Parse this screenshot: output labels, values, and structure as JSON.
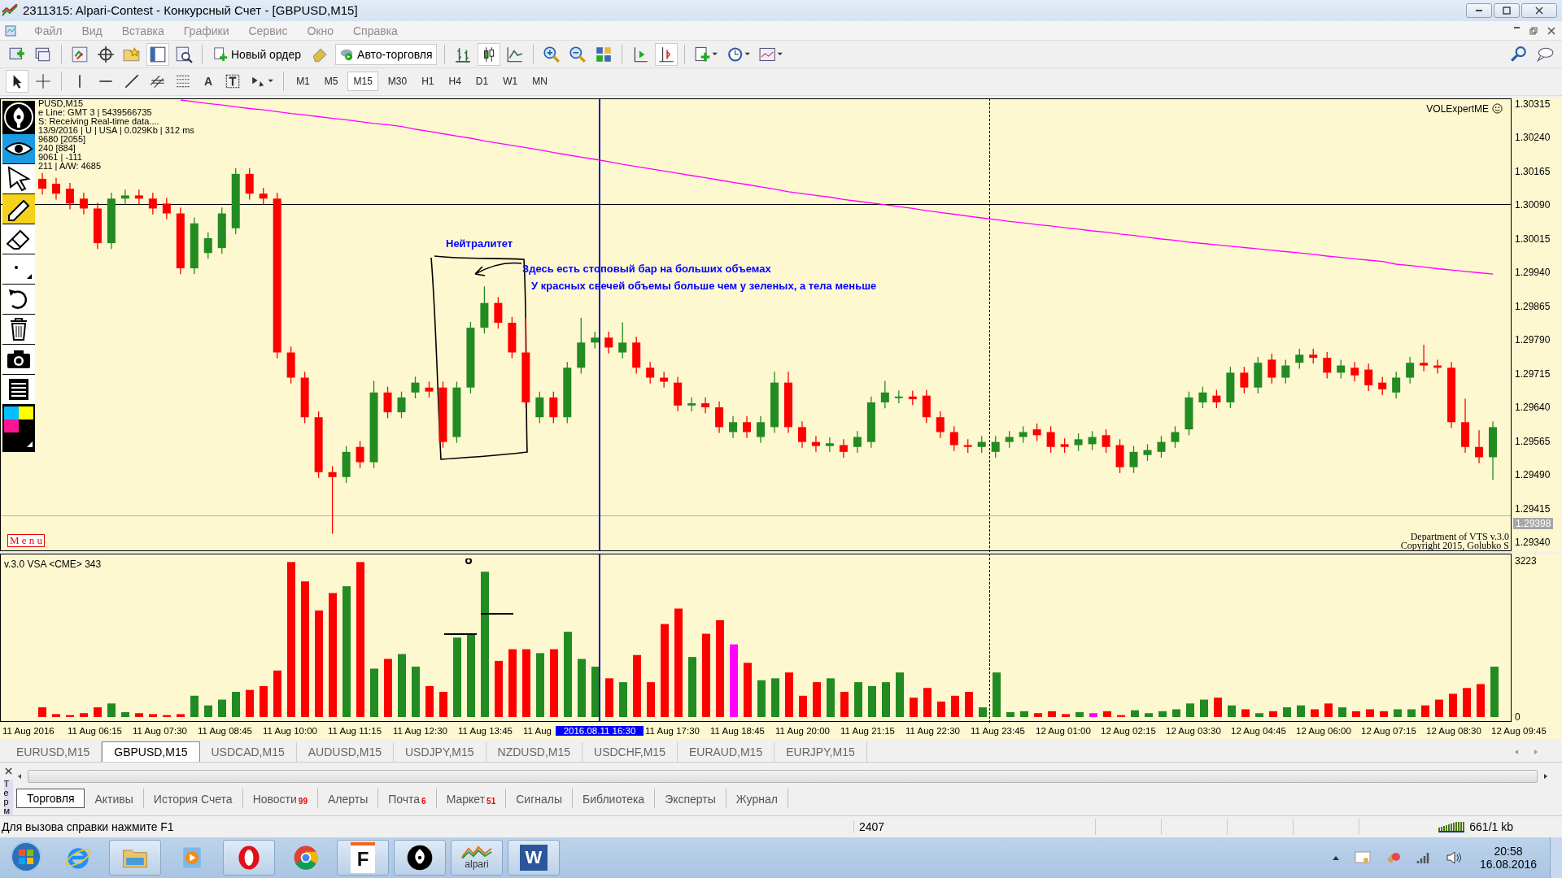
{
  "window": {
    "title": "2311315: Alpari-Contest - Конкурсный Счет - [GBPUSD,M15]"
  },
  "menu": [
    "Файл",
    "Вид",
    "Вставка",
    "Графики",
    "Сервис",
    "Окно",
    "Справка"
  ],
  "toolbar": {
    "new_order": "Новый ордер",
    "auto_trading": "Авто-торговля",
    "text_tool": "A"
  },
  "timeframes": [
    {
      "label": "M1",
      "selected": false
    },
    {
      "label": "M5",
      "selected": false
    },
    {
      "label": "M15",
      "selected": true
    },
    {
      "label": "M30",
      "selected": false
    },
    {
      "label": "H1",
      "selected": false
    },
    {
      "label": "H4",
      "selected": false
    },
    {
      "label": "D1",
      "selected": false
    },
    {
      "label": "W1",
      "selected": false
    },
    {
      "label": "MN",
      "selected": false
    }
  ],
  "chart": {
    "info_lines": [
      "PUSD,M15",
      "e Line: GMT 3 | 5439566735",
      "S:  Receiving Real-time data....",
      "13/9/2016 | U | USA | 0.029Kb | 312 ms",
      "9680  [2055]",
      "240  [884]",
      "9061 | -111",
      "211 | A/W: 4685"
    ],
    "expert": "VOLExpertME",
    "menu_label": "M e n u",
    "credits": [
      "Department of VTS  v.3.0",
      "Copyright 2015, Golubko S"
    ],
    "annotations": [
      "Нейтралитет",
      "Здесь есть стоповый бар на больших объемах",
      "У красных свечей объемы больше чем у зеленых, а тела меньше"
    ],
    "current_price": "1.29398",
    "chart_data": {
      "type": "candlestick",
      "ylim": [
        1.29323,
        1.30326
      ],
      "ref_lines": [
        {
          "axis": "y",
          "value": 1.3009,
          "color": "#000000"
        },
        {
          "axis": "y",
          "value": 1.29398,
          "color": "#b0b0b0"
        }
      ],
      "series": [
        {
          "type": "line",
          "color": "#ff00ff",
          "values": [
            null,
            null,
            null,
            null,
            null,
            null,
            null,
            null,
            null,
            null,
            1.30323,
            1.30319,
            1.30315,
            1.30312,
            1.30308,
            1.30304,
            1.30301,
            1.30297,
            1.30293,
            1.3029,
            1.30286,
            1.30282,
            1.30279,
            1.30275,
            1.30271,
            1.30268,
            1.30264,
            1.30258,
            1.30253,
            1.30248,
            1.30243,
            1.30238,
            1.30232,
            1.30227,
            1.30222,
            1.30217,
            1.30212,
            1.30206,
            1.30201,
            1.30196,
            1.30191,
            1.30186,
            1.3018,
            1.30175,
            1.3017,
            1.30165,
            1.3016,
            1.30155,
            1.3015,
            1.30145,
            1.3014,
            1.30135,
            1.3013,
            1.30125,
            1.30119,
            1.30115,
            1.30111,
            1.30107,
            1.30102,
            1.30098,
            1.30094,
            1.3009,
            1.30086,
            1.30082,
            1.30077,
            1.30073,
            1.30069,
            1.30065,
            1.30061,
            1.30057,
            1.30053,
            1.3005,
            1.30046,
            1.30043,
            1.30039,
            1.30036,
            1.30032,
            1.30029,
            1.30025,
            1.30022,
            1.30018,
            1.30014,
            1.30011,
            1.30007,
            1.30004,
            1.30001,
            1.29998,
            1.29995,
            1.29992,
            1.29989,
            1.29986,
            1.29983,
            1.2998,
            1.29976,
            1.29973,
            1.2997,
            1.29967,
            1.29964,
            1.29958,
            1.29955,
            1.29952,
            1.29948,
            1.29945,
            1.29942,
            1.29939,
            1.29936
          ]
        }
      ],
      "yticks": [
        {
          "value": 1.30315,
          "label": "1.30315"
        },
        {
          "value": 1.3024,
          "label": "1.30240"
        },
        {
          "value": 1.30165,
          "label": "1.30165"
        },
        {
          "value": 1.3009,
          "label": "1.30090"
        },
        {
          "value": 1.30015,
          "label": "1.30015"
        },
        {
          "value": 1.2994,
          "label": "1.29940"
        },
        {
          "value": 1.29865,
          "label": "1.29865"
        },
        {
          "value": 1.2979,
          "label": "1.29790"
        },
        {
          "value": 1.29715,
          "label": "1.29715"
        },
        {
          "value": 1.2964,
          "label": "1.29640"
        },
        {
          "value": 1.29565,
          "label": "1.29565"
        },
        {
          "value": 1.2949,
          "label": "1.29490"
        },
        {
          "value": 1.29415,
          "label": "1.29415"
        },
        {
          "value": 1.2934,
          "label": "1.29340"
        }
      ],
      "categories": [
        null,
        null,
        null,
        null,
        null,
        null,
        null,
        null,
        null,
        null,
        null,
        null,
        null,
        null,
        null,
        null,
        null,
        null,
        null,
        null,
        null,
        null,
        null,
        null,
        null,
        null,
        null,
        null,
        null,
        null,
        null,
        null,
        null,
        null,
        null,
        null,
        null,
        null,
        null,
        null,
        null,
        null,
        null,
        null,
        null,
        null,
        null,
        null,
        null,
        null,
        null,
        null,
        null,
        null,
        null,
        null,
        null,
        null,
        null,
        null,
        null,
        null,
        null,
        null,
        null,
        null,
        null,
        null,
        null,
        null,
        null,
        null,
        null,
        null,
        null,
        null,
        null,
        null,
        null,
        null,
        null,
        null,
        null,
        null,
        null,
        null,
        null,
        null,
        null,
        null,
        null,
        null,
        null,
        null,
        null,
        null,
        null,
        null,
        null,
        null,
        null,
        null,
        null,
        null,
        null,
        null
      ],
      "ohlc": [
        [
          1.30149,
          1.30162,
          1.30114,
          1.30127
        ],
        [
          1.30138,
          1.30151,
          1.30103,
          1.30116
        ],
        [
          1.30127,
          1.3014,
          1.30081,
          1.30094
        ],
        [
          1.30105,
          1.30118,
          1.3007,
          1.30083
        ],
        [
          1.30083,
          1.30096,
          1.29993,
          1.30006
        ],
        [
          1.30006,
          1.30118,
          1.29993,
          1.30105
        ],
        [
          1.30105,
          1.30125,
          1.30092,
          1.30112
        ],
        [
          1.30112,
          1.30125,
          1.30092,
          1.30105
        ],
        [
          1.30105,
          1.30118,
          1.3007,
          1.30083
        ],
        [
          1.30094,
          1.30107,
          1.30059,
          1.30072
        ],
        [
          1.30072,
          1.30085,
          1.29937,
          1.2995
        ],
        [
          1.2995,
          1.30063,
          1.29937,
          1.3005
        ],
        [
          1.29984,
          1.3003,
          1.29971,
          1.30017
        ],
        [
          1.29995,
          1.30085,
          1.29982,
          1.30072
        ],
        [
          1.30039,
          1.30173,
          1.30026,
          1.3016
        ],
        [
          1.3016,
          1.30173,
          1.30103,
          1.30116
        ],
        [
          1.30116,
          1.30129,
          1.30092,
          1.30105
        ],
        [
          1.30105,
          1.30118,
          1.2975,
          1.29763
        ],
        [
          1.29763,
          1.29776,
          1.29694,
          1.29707
        ],
        [
          1.29707,
          1.2972,
          1.29606,
          1.29619
        ],
        [
          1.29619,
          1.29632,
          1.29484,
          1.29497
        ],
        [
          1.29497,
          1.2951,
          1.2936,
          1.29486
        ],
        [
          1.29486,
          1.29555,
          1.29473,
          1.29542
        ],
        [
          1.29553,
          1.29566,
          1.29506,
          1.29519
        ],
        [
          1.29519,
          1.297,
          1.29506,
          1.29674
        ],
        [
          1.29674,
          1.29687,
          1.29617,
          1.2963
        ],
        [
          1.2963,
          1.29676,
          1.29617,
          1.29663
        ],
        [
          1.29674,
          1.29709,
          1.29661,
          1.29696
        ],
        [
          1.29685,
          1.29698,
          1.29663,
          1.29676
        ],
        [
          1.29685,
          1.29698,
          1.29551,
          1.29564
        ],
        [
          1.29575,
          1.29698,
          1.29562,
          1.29685
        ],
        [
          1.29685,
          1.29831,
          1.29672,
          1.29818
        ],
        [
          1.29818,
          1.2991,
          1.29805,
          1.29873
        ],
        [
          1.29873,
          1.29886,
          1.29816,
          1.29829
        ],
        [
          1.29829,
          1.29842,
          1.2975,
          1.29763
        ],
        [
          1.29763,
          1.2984,
          1.29639,
          1.29652
        ],
        [
          1.29619,
          1.29676,
          1.29606,
          1.29663
        ],
        [
          1.29663,
          1.29676,
          1.29606,
          1.29619
        ],
        [
          1.29619,
          1.29742,
          1.29606,
          1.29729
        ],
        [
          1.29729,
          1.2984,
          1.29716,
          1.29785
        ],
        [
          1.29785,
          1.29809,
          1.29772,
          1.29796
        ],
        [
          1.29796,
          1.29809,
          1.29761,
          1.29774
        ],
        [
          1.29763,
          1.2983,
          1.2975,
          1.29785
        ],
        [
          1.29785,
          1.29798,
          1.29716,
          1.29729
        ],
        [
          1.29729,
          1.29742,
          1.29694,
          1.29707
        ],
        [
          1.29707,
          1.2972,
          1.29685,
          1.29698
        ],
        [
          1.29696,
          1.29709,
          1.29632,
          1.29645
        ],
        [
          1.29645,
          1.29663,
          1.29632,
          1.2965
        ],
        [
          1.2965,
          1.29663,
          1.29628,
          1.29641
        ],
        [
          1.29641,
          1.29654,
          1.29584,
          1.29597
        ],
        [
          1.29586,
          1.29621,
          1.29573,
          1.29608
        ],
        [
          1.29608,
          1.29621,
          1.29573,
          1.29586
        ],
        [
          1.29575,
          1.29621,
          1.29562,
          1.29608
        ],
        [
          1.29597,
          1.2972,
          1.29584,
          1.29696
        ],
        [
          1.29696,
          1.2972,
          1.29584,
          1.29597
        ],
        [
          1.29597,
          1.2961,
          1.29551,
          1.29564
        ],
        [
          1.29564,
          1.29577,
          1.29542,
          1.29555
        ],
        [
          1.29555,
          1.29574,
          1.29542,
          1.29561
        ],
        [
          1.29557,
          1.2957,
          1.29529,
          1.29542
        ],
        [
          1.29553,
          1.29588,
          1.2954,
          1.29575
        ],
        [
          1.29564,
          1.29665,
          1.29551,
          1.29652
        ],
        [
          1.29652,
          1.297,
          1.29639,
          1.29674
        ],
        [
          1.29663,
          1.29678,
          1.2965,
          1.29665
        ],
        [
          1.29665,
          1.29678,
          1.29646,
          1.29659
        ],
        [
          1.29667,
          1.2968,
          1.29606,
          1.29619
        ],
        [
          1.29619,
          1.29632,
          1.29573,
          1.29586
        ],
        [
          1.29586,
          1.29599,
          1.29544,
          1.29557
        ],
        [
          1.29557,
          1.2957,
          1.2954,
          1.29553
        ],
        [
          1.29553,
          1.29577,
          1.2954,
          1.29564
        ],
        [
          1.29542,
          1.29577,
          1.29529,
          1.29564
        ],
        [
          1.29564,
          1.29588,
          1.29551,
          1.29575
        ],
        [
          1.29575,
          1.29599,
          1.29562,
          1.29586
        ],
        [
          1.29592,
          1.29605,
          1.29566,
          1.29579
        ],
        [
          1.29586,
          1.29599,
          1.2954,
          1.29553
        ],
        [
          1.29559,
          1.29572,
          1.2954,
          1.29553
        ],
        [
          1.29557,
          1.29583,
          1.29544,
          1.2957
        ],
        [
          1.29559,
          1.29588,
          1.29546,
          1.29575
        ],
        [
          1.29579,
          1.29592,
          1.2954,
          1.29553
        ],
        [
          1.29557,
          1.2957,
          1.29495,
          1.29508
        ],
        [
          1.29508,
          1.29555,
          1.29495,
          1.29542
        ],
        [
          1.29535,
          1.29559,
          1.29522,
          1.29546
        ],
        [
          1.29542,
          1.29577,
          1.29529,
          1.29564
        ],
        [
          1.29564,
          1.29599,
          1.29551,
          1.29586
        ],
        [
          1.29592,
          1.29676,
          1.29579,
          1.29663
        ],
        [
          1.29652,
          1.29687,
          1.29639,
          1.29674
        ],
        [
          1.29667,
          1.2968,
          1.29639,
          1.29652
        ],
        [
          1.29652,
          1.29731,
          1.29639,
          1.29718
        ],
        [
          1.29718,
          1.29731,
          1.29672,
          1.29685
        ],
        [
          1.29685,
          1.29753,
          1.29672,
          1.2974
        ],
        [
          1.29747,
          1.2976,
          1.29694,
          1.29707
        ],
        [
          1.29707,
          1.29747,
          1.29694,
          1.29734
        ],
        [
          1.2974,
          1.29771,
          1.29727,
          1.29758
        ],
        [
          1.29758,
          1.29771,
          1.29738,
          1.29751
        ],
        [
          1.29751,
          1.29764,
          1.29705,
          1.29718
        ],
        [
          1.29718,
          1.29747,
          1.29705,
          1.29734
        ],
        [
          1.29729,
          1.29742,
          1.29699,
          1.29712
        ],
        [
          1.29725,
          1.29738,
          1.29677,
          1.2969
        ],
        [
          1.29696,
          1.29709,
          1.29668,
          1.29681
        ],
        [
          1.29674,
          1.2972,
          1.29661,
          1.29707
        ],
        [
          1.29707,
          1.29753,
          1.29694,
          1.2974
        ],
        [
          1.2974,
          1.2978,
          1.29721,
          1.29734
        ],
        [
          1.29734,
          1.29747,
          1.29716,
          1.29729
        ],
        [
          1.29729,
          1.29742,
          1.29595,
          1.29608
        ],
        [
          1.29608,
          1.2966,
          1.2954,
          1.29553
        ],
        [
          1.29553,
          1.2959,
          1.29517,
          1.2953
        ],
        [
          1.2953,
          1.2961,
          1.2948,
          1.29597
        ]
      ]
    },
    "volume_pane": {
      "label": "v.3.0 VSA <CME> 343",
      "chart_data": {
        "type": "bar",
        "stacked": true,
        "ylim": [
          0,
          3223
        ],
        "yticks": [
          {
            "value": 3223,
            "label": "3223"
          },
          {
            "value": 0,
            "label": "0"
          }
        ],
        "categories": [
          null,
          null,
          null,
          null,
          null,
          null,
          null,
          null,
          null,
          null,
          null,
          null,
          null,
          null,
          null,
          null,
          null,
          null,
          null,
          null,
          null,
          null,
          null,
          null,
          null,
          null,
          null,
          null,
          null,
          null,
          null,
          null,
          null,
          null,
          null,
          null,
          null,
          null,
          null,
          null,
          null,
          null,
          null,
          null,
          null,
          null,
          null,
          null,
          null,
          null,
          null,
          null,
          null,
          null,
          null,
          null,
          null,
          null,
          null,
          null,
          null,
          null,
          null,
          null,
          null,
          null,
          null,
          null,
          null,
          null,
          null,
          null,
          null,
          null,
          null,
          null,
          null,
          null,
          null,
          null,
          null,
          null,
          null,
          null,
          null,
          null,
          null,
          null,
          null,
          null,
          null,
          null,
          null,
          null,
          null,
          null,
          null,
          null,
          null,
          null,
          null,
          null,
          null,
          null,
          null,
          null
        ],
        "series": [
          {
            "color": "#228b22",
            "values": [
              null,
              null,
              null,
              null,
              null,
              280,
              100,
              null,
              null,
              null,
              null,
              440,
              240,
              360,
              520,
              null,
              null,
              null,
              null,
              null,
              null,
              null,
              2700,
              null,
              1000,
              null,
              1300,
              1040,
              null,
              null,
              1640,
              1720,
              3000,
              null,
              null,
              null,
              1320,
              null,
              1760,
              1200,
              1040,
              null,
              720,
              null,
              null,
              null,
              null,
              1240,
              null,
              null,
              null,
              null,
              760,
              800,
              null,
              null,
              null,
              800,
              null,
              720,
              640,
              720,
              920,
              null,
              null,
              null,
              null,
              null,
              200,
              920,
              100,
              120,
              null,
              null,
              null,
              100,
              null,
              null,
              null,
              140,
              80,
              120,
              160,
              280,
              360,
              null,
              240,
              null,
              80,
              null,
              200,
              240,
              null,
              null,
              200,
              null,
              null,
              null,
              160,
              160,
              null,
              null,
              null,
              null,
              null,
              1040
            ]
          },
          {
            "color": "#ff0000",
            "values": [
              200,
              60,
              40,
              80,
              200,
              null,
              null,
              80,
              60,
              40,
              60,
              null,
              null,
              null,
              null,
              560,
              640,
              960,
              3200,
              2800,
              2200,
              2560,
              null,
              3200,
              null,
              1200,
              null,
              null,
              640,
              520,
              null,
              null,
              null,
              1160,
              1400,
              1400,
              null,
              1400,
              null,
              null,
              null,
              800,
              null,
              1280,
              720,
              1920,
              2240,
              null,
              1720,
              2000,
              null,
              1120,
              null,
              null,
              920,
              440,
              720,
              null,
              520,
              null,
              null,
              null,
              null,
              400,
              600,
              320,
              440,
              520,
              null,
              null,
              null,
              null,
              80,
              120,
              60,
              null,
              null,
              120,
              40,
              null,
              null,
              null,
              null,
              null,
              null,
              400,
              null,
              160,
              null,
              120,
              null,
              null,
              160,
              280,
              null,
              120,
              160,
              120,
              null,
              null,
              240,
              360,
              480,
              600,
              680,
              null
            ]
          },
          {
            "color": "#ff00ff",
            "values": [
              null,
              null,
              null,
              null,
              null,
              null,
              null,
              null,
              null,
              null,
              null,
              null,
              null,
              null,
              null,
              null,
              null,
              null,
              null,
              null,
              null,
              null,
              null,
              null,
              null,
              null,
              null,
              null,
              null,
              null,
              null,
              null,
              null,
              null,
              null,
              null,
              null,
              null,
              null,
              null,
              null,
              null,
              null,
              null,
              null,
              null,
              null,
              null,
              null,
              null,
              1500,
              null,
              null,
              null,
              null,
              null,
              null,
              null,
              null,
              null,
              null,
              null,
              null,
              null,
              null,
              null,
              null,
              null,
              null,
              null,
              null,
              null,
              null,
              null,
              null,
              null,
              80,
              null,
              null,
              null,
              null,
              null,
              null,
              null,
              null,
              null,
              null,
              null,
              null,
              null,
              null,
              null,
              null,
              null,
              null,
              null,
              null,
              null,
              null,
              null,
              null,
              null,
              null,
              null,
              null,
              null
            ]
          }
        ]
      }
    },
    "time_labels_before": [
      "11 Aug 2016",
      "11 Aug 06:15",
      "11 Aug 07:30",
      "11 Aug 08:45",
      "11 Aug 10:00",
      "11 Aug 11:15",
      "11 Aug 12:30",
      "11 Aug 13:45",
      "11 Aug"
    ],
    "time_cursor": "2016.08.11 16:30",
    "time_labels_after": [
      "11 Aug 17:30",
      "11 Aug 18:45",
      "11 Aug 20:00",
      "11 Aug 21:15",
      "11 Aug 22:30",
      "11 Aug 23:45",
      "12 Aug 01:00",
      "12 Aug 02:15",
      "12 Aug 03:30",
      "12 Aug 04:45",
      "12 Aug 06:00",
      "12 Aug 07:15",
      "12 Aug 08:30",
      "12 Aug 09:45"
    ]
  },
  "symbol_tabs": [
    {
      "label": "EURUSD,M15",
      "selected": false
    },
    {
      "label": "GBPUSD,M15",
      "selected": true
    },
    {
      "label": "USDCAD,M15",
      "selected": false
    },
    {
      "label": "AUDUSD,M15",
      "selected": false
    },
    {
      "label": "USDJPY,M15",
      "selected": false
    },
    {
      "label": "NZDUSD,M15",
      "selected": false
    },
    {
      "label": "USDCHF,M15",
      "selected": false
    },
    {
      "label": "EURAUD,M15",
      "selected": false
    },
    {
      "label": "EURJPY,M15",
      "selected": false
    }
  ],
  "terminal": {
    "side_label": "Терм",
    "tabs": [
      {
        "label": "Торговля",
        "selected": true
      },
      {
        "label": "Активы",
        "selected": false
      },
      {
        "label": "История Счета",
        "selected": false
      },
      {
        "label": "Новости",
        "badge": "99",
        "selected": false
      },
      {
        "label": "Алерты",
        "selected": false
      },
      {
        "label": "Почта",
        "badge": "6",
        "selected": false
      },
      {
        "label": "Маркет",
        "badge": "51",
        "selected": false
      },
      {
        "label": "Сигналы",
        "selected": false
      },
      {
        "label": "Библиотека",
        "selected": false
      },
      {
        "label": "Эксперты",
        "selected": false
      },
      {
        "label": "Журнал",
        "selected": false
      }
    ]
  },
  "status_bar": {
    "help": "Для вызова справки нажмите F1",
    "bars": "2407",
    "traffic": "661/1 kb"
  },
  "taskbar": {
    "apps": [
      {
        "kind": "ie"
      },
      {
        "kind": "folder"
      },
      {
        "kind": "media"
      },
      {
        "kind": "opera"
      },
      {
        "kind": "chrome"
      },
      {
        "kind": "f",
        "label": "F"
      },
      {
        "kind": "pen"
      },
      {
        "kind": "alpari",
        "label": "alpari"
      },
      {
        "kind": "word",
        "label": "W"
      }
    ],
    "time": "20:58",
    "date": "16.08.2016"
  }
}
